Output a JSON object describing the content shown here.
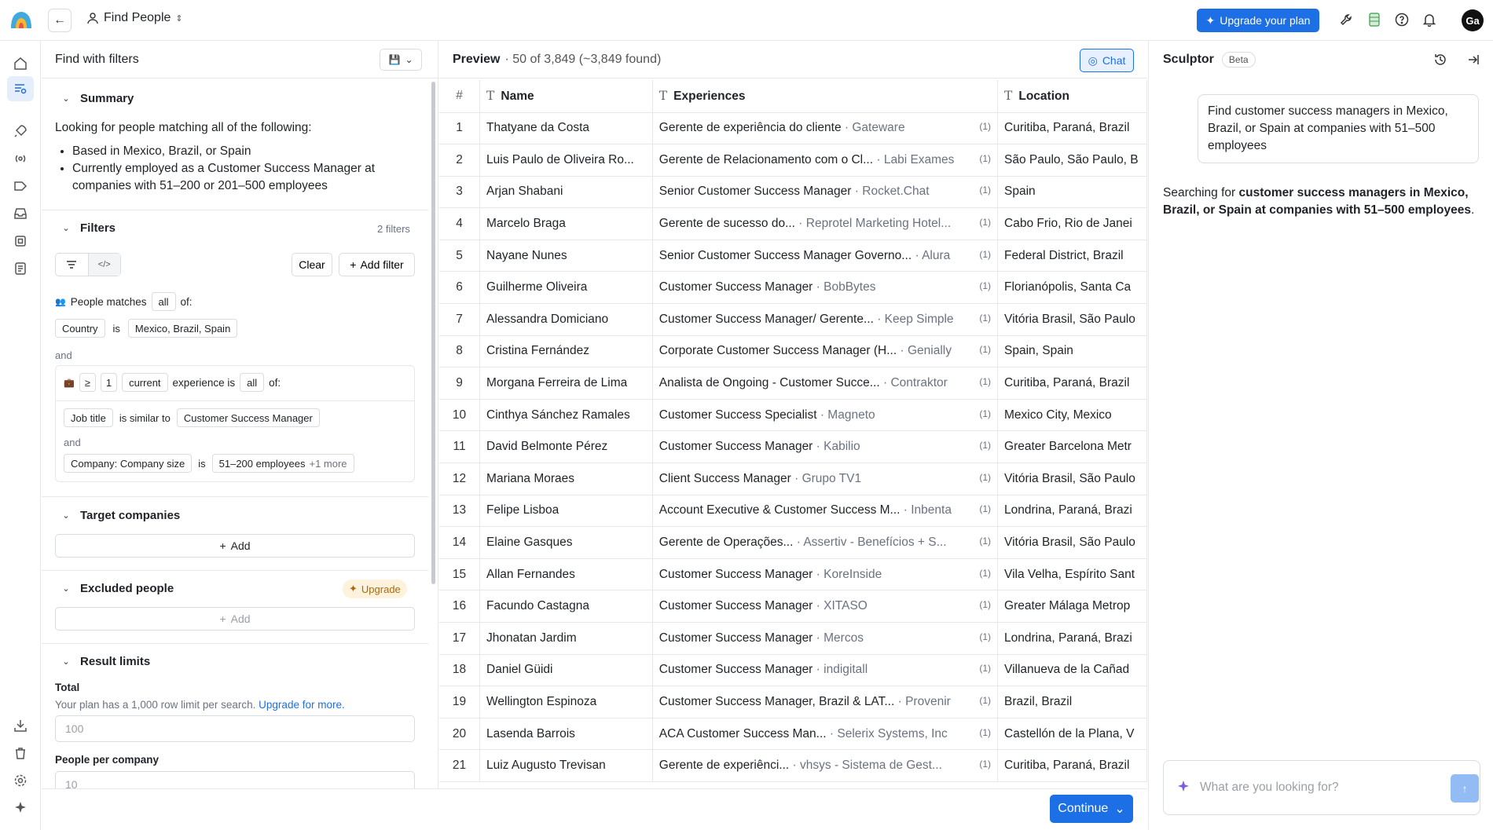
{
  "header": {
    "back_label": "←",
    "title": "Find People",
    "upgrade_label": "Upgrade your plan",
    "avatar_initials": "Ga"
  },
  "filters_panel": {
    "title": "Find with filters",
    "summary": {
      "title": "Summary",
      "intro": "Looking for people matching all of the following:",
      "bullets": [
        "Based in Mexico, Brazil, or Spain",
        "Currently employed as a Customer Success Manager at companies with 51–200 or 201–500 employees"
      ]
    },
    "filters": {
      "title": "Filters",
      "count": "2 filters",
      "clear_label": "Clear",
      "add_filter_label": "Add filter",
      "people_matches": "People matches",
      "all": "all",
      "of": "of:",
      "country_field": "Country",
      "is": "is",
      "country_value": "Mexico, Brazil, Spain",
      "and": "and",
      "gte": "≥",
      "one": "1",
      "current": "current",
      "experience_is": "experience is",
      "job_title_field": "Job title",
      "is_similar_to": "is similar to",
      "job_title_value": "Customer Success Manager",
      "company_size_field": "Company: Company size",
      "company_size_value": "51–200 employees",
      "more": "+1 more"
    },
    "target_companies": {
      "title": "Target companies",
      "add_label": "Add"
    },
    "excluded_people": {
      "title": "Excluded people",
      "upgrade_label": "Upgrade",
      "add_label": "Add"
    },
    "result_limits": {
      "title": "Result limits",
      "total_label": "Total",
      "plan_note": "Your plan has a 1,000 row limit per search.",
      "upgrade_link": "Upgrade for more.",
      "total_placeholder": "100",
      "per_company_label": "People per company",
      "per_company_placeholder": "10"
    }
  },
  "preview": {
    "title": "Preview",
    "summary": "· 50 of 3,849 (~3,849 found)",
    "chat_label": "Chat",
    "columns": [
      "#",
      "Name",
      "Experiences",
      "Location"
    ],
    "rows": [
      {
        "n": "1",
        "name": "Thatyane da Costa",
        "role": "Gerente de experiência do cliente",
        "company": "Gateware",
        "count": "(1)",
        "location": "Curitiba, Paraná, Brazil"
      },
      {
        "n": "2",
        "name": "Luis Paulo de Oliveira Ro...",
        "role": "Gerente de Relacionamento com o Cl...",
        "company": "Labi Exames",
        "count": "(1)",
        "location": "São Paulo, São Paulo, B"
      },
      {
        "n": "3",
        "name": "Arjan Shabani",
        "role": "Senior Customer Success Manager",
        "company": "Rocket.Chat",
        "count": "(1)",
        "location": "Spain"
      },
      {
        "n": "4",
        "name": "Marcelo Braga",
        "role": "Gerente de sucesso do...",
        "company": "Reprotel Marketing Hotel...",
        "count": "(1)",
        "location": "Cabo Frio, Rio de Janei"
      },
      {
        "n": "5",
        "name": "Nayane Nunes",
        "role": "Senior Customer Success Manager Governo...",
        "company": "Alura",
        "count": "(1)",
        "location": "Federal District, Brazil"
      },
      {
        "n": "6",
        "name": "Guilherme Oliveira",
        "role": "Customer Success Manager",
        "company": "BobBytes",
        "count": "(1)",
        "location": "Florianópolis, Santa Ca"
      },
      {
        "n": "7",
        "name": "Alessandra Domiciano",
        "role": "Customer Success Manager/ Gerente...",
        "company": "Keep Simple",
        "count": "(1)",
        "location": "Vitória Brasil, São Paulo"
      },
      {
        "n": "8",
        "name": "Cristina Fernández",
        "role": "Corporate Customer Success Manager (H...",
        "company": "Genially",
        "count": "(1)",
        "location": "Spain, Spain"
      },
      {
        "n": "9",
        "name": "Morgana Ferreira de Lima",
        "role": "Analista de Ongoing - Customer Succe...",
        "company": "Contraktor",
        "count": "(1)",
        "location": "Curitiba, Paraná, Brazil"
      },
      {
        "n": "10",
        "name": "Cinthya Sánchez Ramales",
        "role": "Customer Success Specialist",
        "company": "Magneto",
        "count": "(1)",
        "location": "Mexico City, Mexico"
      },
      {
        "n": "11",
        "name": "David Belmonte Pérez",
        "role": "Customer Success Manager",
        "company": "Kabilio",
        "count": "(1)",
        "location": "Greater Barcelona Metr"
      },
      {
        "n": "12",
        "name": "Mariana Moraes",
        "role": "Client Success Manager",
        "company": "Grupo TV1",
        "count": "(1)",
        "location": "Vitória Brasil, São Paulo"
      },
      {
        "n": "13",
        "name": "Felipe Lisboa",
        "role": "Account Executive & Customer Success M...",
        "company": "Inbenta",
        "count": "(1)",
        "location": "Londrina, Paraná, Brazi"
      },
      {
        "n": "14",
        "name": "Elaine Gasques",
        "role": "Gerente de Operações...",
        "company": "Assertiv - Benefícios + S...",
        "count": "(1)",
        "location": "Vitória Brasil, São Paulo"
      },
      {
        "n": "15",
        "name": "Allan Fernandes",
        "role": "Customer Success Manager",
        "company": "KoreInside",
        "count": "(1)",
        "location": "Vila Velha, Espírito Sant"
      },
      {
        "n": "16",
        "name": "Facundo Castagna",
        "role": "Customer Success Manager",
        "company": "XITASO",
        "count": "(1)",
        "location": "Greater Málaga Metrop"
      },
      {
        "n": "17",
        "name": "Jhonatan Jardim",
        "role": "Customer Success Manager",
        "company": "Mercos",
        "count": "(1)",
        "location": "Londrina, Paraná, Brazi"
      },
      {
        "n": "18",
        "name": "Daniel Güidi",
        "role": "Customer Success Manager",
        "company": "indigitall",
        "count": "(1)",
        "location": "Villanueva de la Cañad"
      },
      {
        "n": "19",
        "name": "Wellington Espinoza",
        "role": "Customer Success Manager, Brazil & LAT...",
        "company": "Provenir",
        "count": "(1)",
        "location": "Brazil, Brazil"
      },
      {
        "n": "20",
        "name": "Lasenda Barrois",
        "role": "ACA Customer Success Man...",
        "company": "Selerix Systems, Inc",
        "count": "(1)",
        "location": "Castellón de la Plana, V"
      },
      {
        "n": "21",
        "name": "Luiz Augusto Trevisan",
        "role": "Gerente de experiênci...",
        "company": "vhsys - Sistema de Gest...",
        "count": "(1)",
        "location": "Curitiba, Paraná, Brazil"
      }
    ],
    "continue_label": "Continue"
  },
  "sculptor": {
    "title": "Sculptor",
    "badge": "Beta",
    "user_message": "Find customer success managers in Mexico, Brazil, or Spain at companies with 51–500 employees",
    "bot_prefix": "Searching for ",
    "bot_bold": "customer success managers in Mexico, Brazil, or Spain at companies with 51–500 employees",
    "bot_suffix": ".",
    "input_placeholder": "What are you looking for?"
  },
  "colors": {
    "accent": "#1d6fe6",
    "upgrade_badge": "#fdf3dc"
  }
}
